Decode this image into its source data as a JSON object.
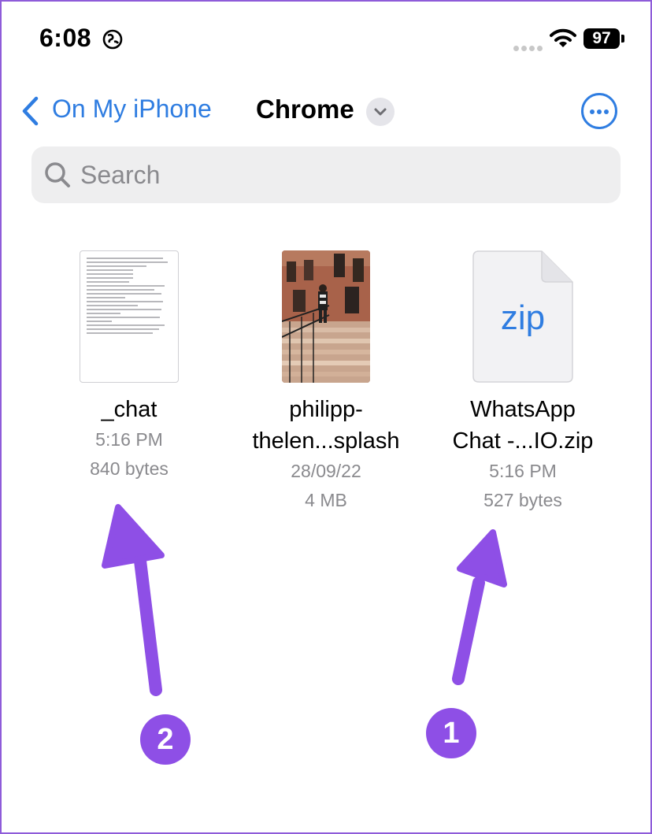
{
  "status_bar": {
    "time": "6:08",
    "battery": "97"
  },
  "nav": {
    "back_label": "On My iPhone",
    "title": "Chrome"
  },
  "search": {
    "placeholder": "Search"
  },
  "files": [
    {
      "name": "_chat",
      "date": "5:16 PM",
      "size": "840 bytes",
      "type": "text-document"
    },
    {
      "name_line1": "philipp-",
      "name_line2": "thelen...splash",
      "date": "28/09/22",
      "size": "4 MB",
      "type": "image"
    },
    {
      "name_line1": "WhatsApp",
      "name_line2": "Chat -...IO.zip",
      "date": "5:16 PM",
      "size": "527 bytes",
      "type": "zip",
      "icon_text": "zip"
    }
  ],
  "annotations": [
    {
      "label": "1",
      "points_to": "zip-file"
    },
    {
      "label": "2",
      "points_to": "chat-file"
    }
  ],
  "colors": {
    "accent": "#2f7de1",
    "annotation": "#8e4fe6"
  }
}
